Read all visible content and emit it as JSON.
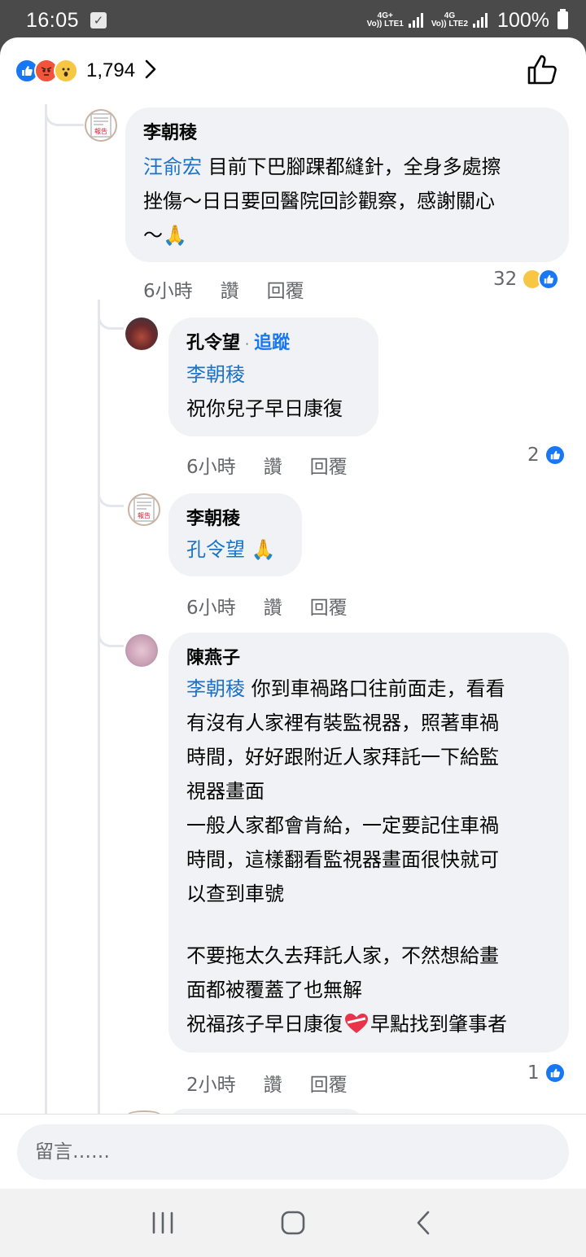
{
  "status_bar": {
    "time": "16:05",
    "sim1_label": "Vo)) LTE1",
    "sim1_tech": "4G+",
    "sim2_label": "Vo)) LTE2",
    "sim2_tech": "4G",
    "battery": "100%"
  },
  "reactions": {
    "icons": [
      "like-icon",
      "angry-icon",
      "wow-icon"
    ],
    "count": "1,794"
  },
  "comments": [
    {
      "author": "李朝稜",
      "mention": "汪俞宏",
      "text_line1": " 目前下巴腳踝都縫針，全身多處擦",
      "text_line2": "挫傷～日日要回醫院回診觀察，感謝關心",
      "text_line3": "～",
      "emoji": "🙏",
      "time": "6小時",
      "like_label": "讚",
      "reply_label": "回覆",
      "reaction_count": "32"
    },
    {
      "author": "孔令望",
      "follow_label": "追蹤",
      "mention": "李朝稜",
      "text_line1": "祝你兒子早日康復",
      "time": "6小時",
      "like_label": "讚",
      "reply_label": "回覆",
      "reaction_count": "2"
    },
    {
      "author": "李朝稜",
      "mention": "孔令望",
      "emoji": "🙏",
      "time": "6小時",
      "like_label": "讚",
      "reply_label": "回覆"
    },
    {
      "author": "陳燕子",
      "mention": "李朝稜",
      "text_line1": " 你到車禍路口往前面走，看看",
      "text_line2": "有沒有人家裡有裝監視器，照著車禍",
      "text_line3": "時間，好好跟附近人家拜託一下給監",
      "text_line4": "視器畫面",
      "text_line5": "一般人家都會肯給，一定要記住車禍",
      "text_line6": "時間，這樣翻看監視器畫面很快就可",
      "text_line7": "以查到車號",
      "text_line8": "不要拖太久去拜託人家，不然想給畫",
      "text_line9": "面都被覆蓋了也無解",
      "text_line10a": "祝福孩子早日康復",
      "text_line10b": "早點找到肇事者",
      "heart_icon": "mending-heart-icon",
      "time": "2小時",
      "like_label": "讚",
      "reply_label": "回覆",
      "reaction_count": "1"
    }
  ],
  "composer": {
    "placeholder": "留言……"
  },
  "colors": {
    "accent": "#1877f2",
    "mention": "#1a73c9",
    "bubble": "#f0f2f5",
    "meta": "#65676b"
  }
}
